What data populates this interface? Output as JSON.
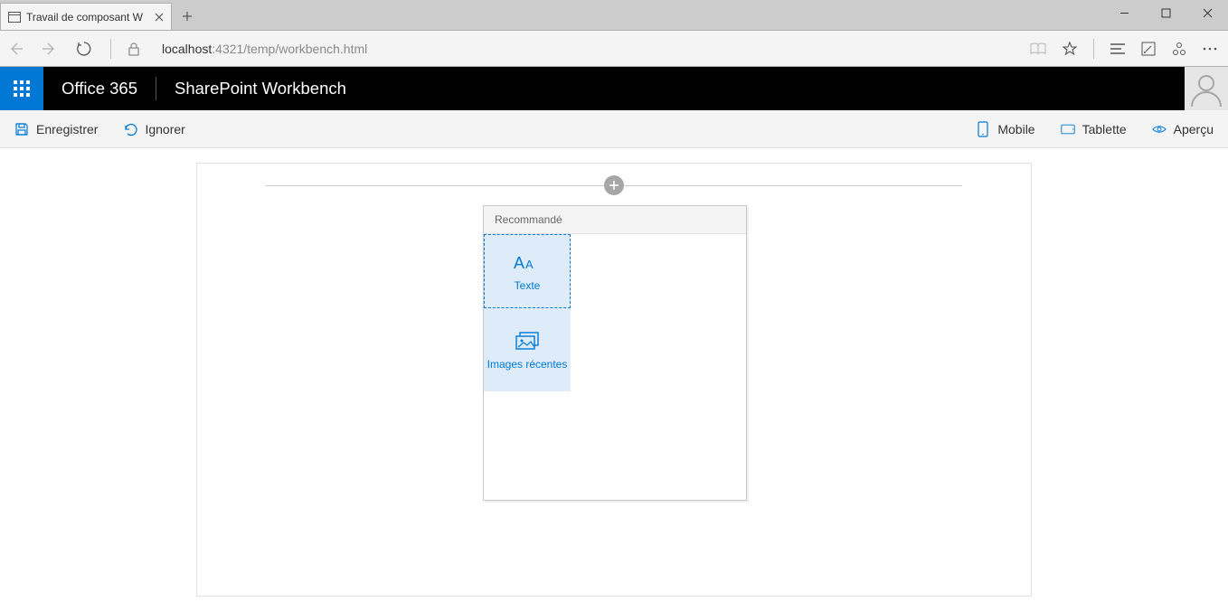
{
  "browser": {
    "tab_title": "Travail de composant W",
    "url_host": "localhost",
    "url_path": ":4321/temp/workbench.html"
  },
  "appbar": {
    "brand": "Office 365",
    "title": "SharePoint Workbench"
  },
  "commands": {
    "save": "Enregistrer",
    "discard": "Ignorer",
    "mobile": "Mobile",
    "tablet": "Tablette",
    "preview": "Aperçu"
  },
  "picker": {
    "header": "Recommandé",
    "tiles": {
      "text": "Texte",
      "recent_images": "Images récentes"
    }
  }
}
